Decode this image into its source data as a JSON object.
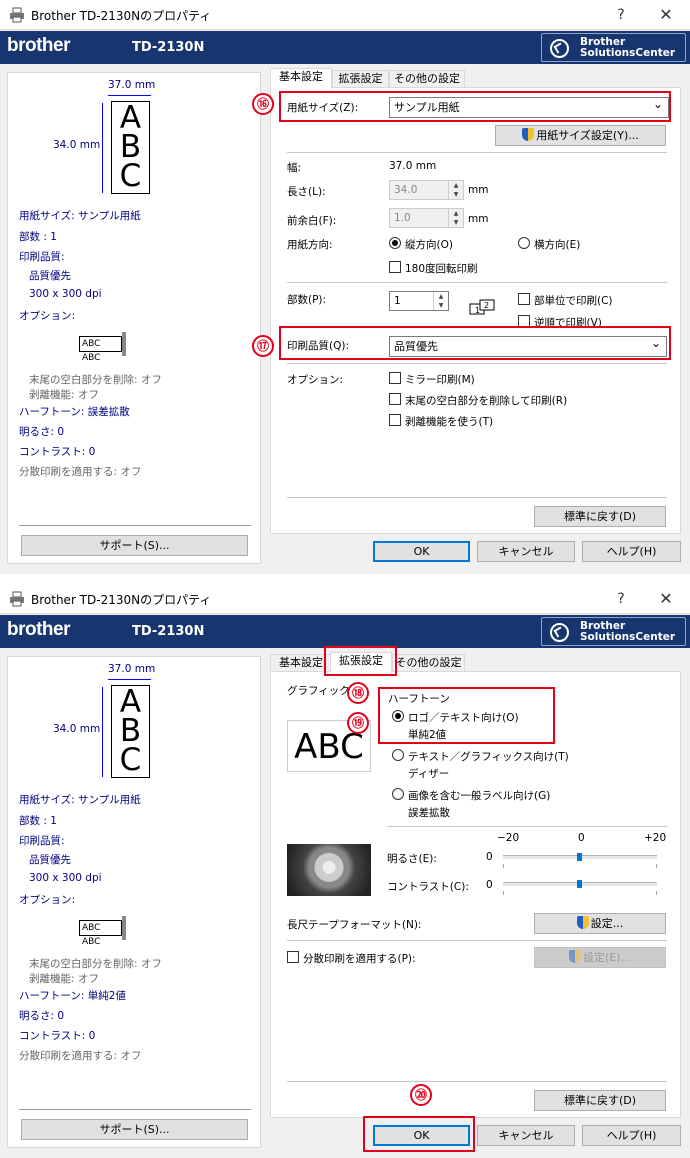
{
  "window_title": "Brother TD-2130Nのプロパティ",
  "help_btn": "?",
  "close_btn": "✕",
  "brand": "brother",
  "model": "TD-2130N",
  "solutions_center": [
    "Brother",
    "SolutionsCenter"
  ],
  "tabs": [
    "基本設定",
    "拡張設定",
    "その他の設定"
  ],
  "preview": {
    "width": "37.0 mm",
    "height": "34.0 mm",
    "label_text": [
      "A",
      "B",
      "C"
    ],
    "mini_label": "ABC ABC"
  },
  "summary1": {
    "paper_size": "用紙サイズ: サンプル用紙",
    "copies": "部数 : 1",
    "quality_label": "印刷品質:",
    "quality": "品質優先",
    "dpi": "300 x 300 dpi",
    "options": "オプション:",
    "trim": "末尾の空白部分を削除: オフ",
    "peel": "剥離機能: オフ",
    "halftone": "ハーフトーン: 誤差拡散",
    "brightness": "明るさ:   0",
    "contrast": "コントラスト:   0",
    "split": "分散印刷を適用する: オフ"
  },
  "summary2": {
    "halftone": "ハーフトーン: 単純2値"
  },
  "support": "サポート(S)...",
  "basic": {
    "paper_size_label": "用紙サイズ(Z):",
    "paper_size": "サンプル用紙",
    "paper_setting_btn": "用紙サイズ設定(Y)...",
    "width_label": "幅:",
    "width_value": "37.0 mm",
    "length_label": "長さ(L):",
    "length_value": "34.0",
    "length_unit": "mm",
    "margin_label": "前余白(F):",
    "margin_value": "1.0",
    "margin_unit": "mm",
    "orient_label": "用紙方向:",
    "portrait": "縦方向(O)",
    "landscape": "横方向(E)",
    "rotate180": "180度回転印刷",
    "copies_label": "部数(P):",
    "copies_value": "1",
    "collate": "部単位で印刷(C)",
    "reverse": "逆順で印刷(V)",
    "quality_label": "印刷品質(Q):",
    "quality": "品質優先",
    "options_label": "オプション:",
    "mirror": "ミラー印刷(M)",
    "trim": "末尾の空白部分を削除して印刷(R)",
    "peel": "剥離機能を使う(T)",
    "default_btn": "標準に戻す(D)"
  },
  "advanced": {
    "graphics_label": "グラフィックス:",
    "abc": "ABC",
    "halftone_label": "ハーフトーン",
    "logo_text": "ロゴ／テキスト向け(O)",
    "binary": "単純2値",
    "text_graphics": "テキスト／グラフィックス向け(T)",
    "dither": "ディザー",
    "image_label": "画像を含む一般ラベル向け(G)",
    "error_diff": "誤差拡散",
    "scale_min": "−20",
    "scale_mid": "0",
    "scale_max": "+20",
    "brightness_label": "明るさ(E):",
    "brightness_value": "0",
    "brightness_level": 0,
    "contrast_label": "コントラスト(C):",
    "contrast_value": "0",
    "contrast_level": 0,
    "long_tape_label": "長尺テープフォーマット(N):",
    "setting_btn": "設定...",
    "split_label": "分散印刷を適用する(P):",
    "setting_btn_disabled": "設定(E)...",
    "default_btn": "標準に戻す(D)"
  },
  "footer": {
    "ok": "OK",
    "cancel": "キャンセル",
    "help": "ヘルプ(H)"
  },
  "badges": [
    "⑯",
    "⑰",
    "⑱",
    "⑲",
    "⑳"
  ],
  "colors": {
    "banner": "#173670",
    "highlight": "#e3001b",
    "summary_text": "#000080"
  }
}
